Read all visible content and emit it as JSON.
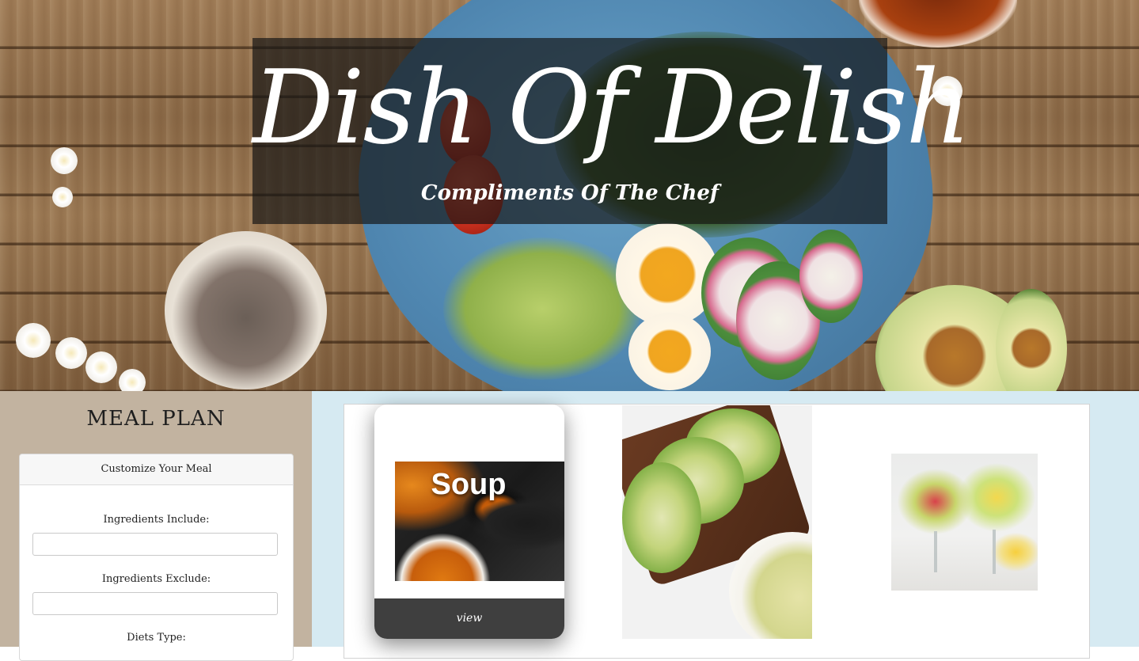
{
  "header": {
    "title": "Dish Of Delish",
    "subtitle": "Compliments Of The Chef"
  },
  "sidebar": {
    "title": "MEAL PLAN",
    "card_header": "Customize Your Meal",
    "fields": [
      {
        "label": "Ingredients Include:",
        "value": ""
      },
      {
        "label": "Ingredients Exclude:",
        "value": ""
      },
      {
        "label": "Diets Type:"
      }
    ]
  },
  "gallery": {
    "cards": [
      {
        "label": "Soup",
        "action": "view"
      }
    ]
  },
  "colors": {
    "sidebar_bg": "#c2b3a0",
    "main_bg": "#d6eaf2",
    "view_bar": "#3f3f3f",
    "title_box": "rgba(20,20,20,0.68)"
  }
}
